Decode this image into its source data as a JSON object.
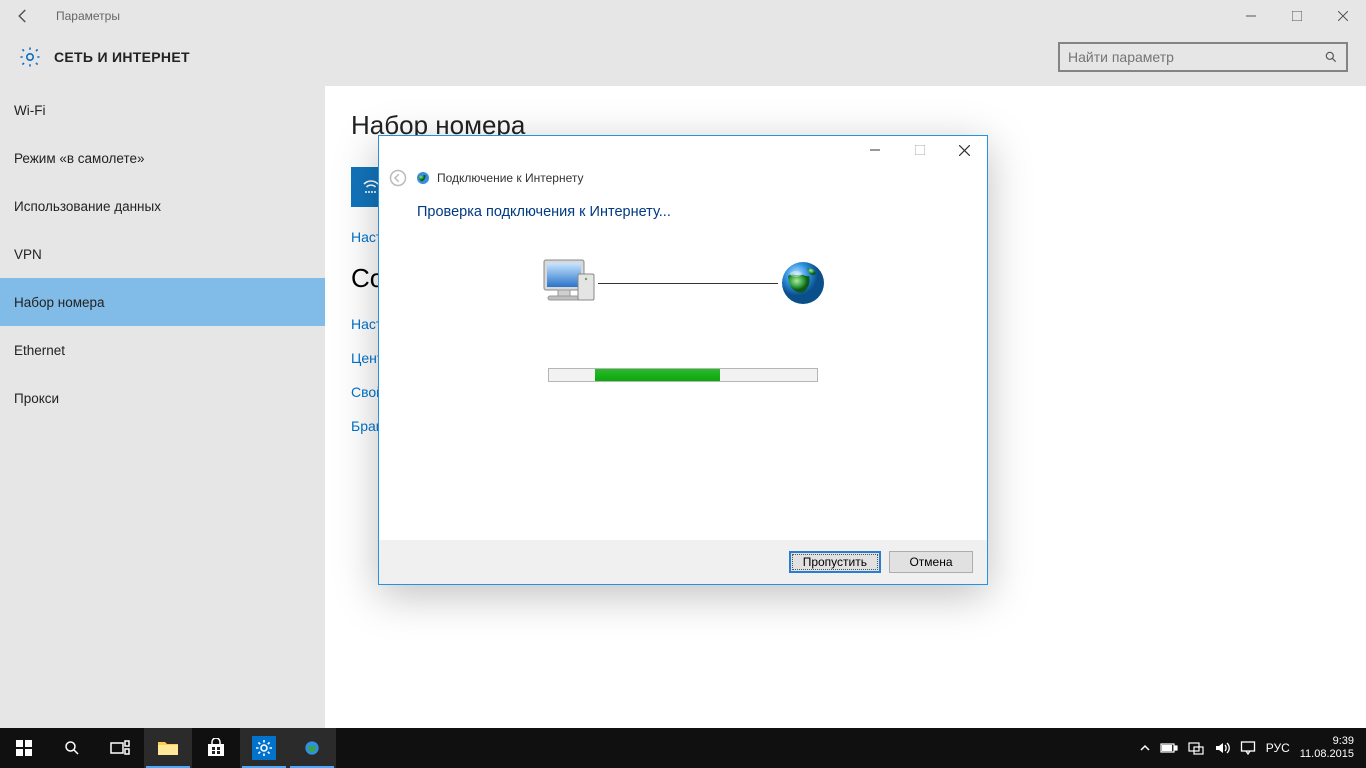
{
  "settings": {
    "window_title": "Параметры",
    "header_title": "СЕТЬ И ИНТЕРНЕТ",
    "search_placeholder": "Найти параметр",
    "sidebar": [
      {
        "label": "Wi-Fi"
      },
      {
        "label": "Режим «в самолете»"
      },
      {
        "label": "Использование данных"
      },
      {
        "label": "VPN"
      },
      {
        "label": "Набор номера"
      },
      {
        "label": "Ethernet"
      },
      {
        "label": "Прокси"
      }
    ],
    "content": {
      "heading": "Набор номера",
      "setup_link": "Настр",
      "related_heading_visible": "Со",
      "links": [
        "Настр",
        "Цент",
        "Свой",
        "Бран"
      ]
    }
  },
  "wizard": {
    "title": "Подключение к Интернету",
    "message": "Проверка подключения к Интернету...",
    "btn_skip": "Пропустить",
    "btn_cancel": "Отмена"
  },
  "system_tray": {
    "lang": "РУС",
    "time": "9:39",
    "date": "11.08.2015"
  }
}
